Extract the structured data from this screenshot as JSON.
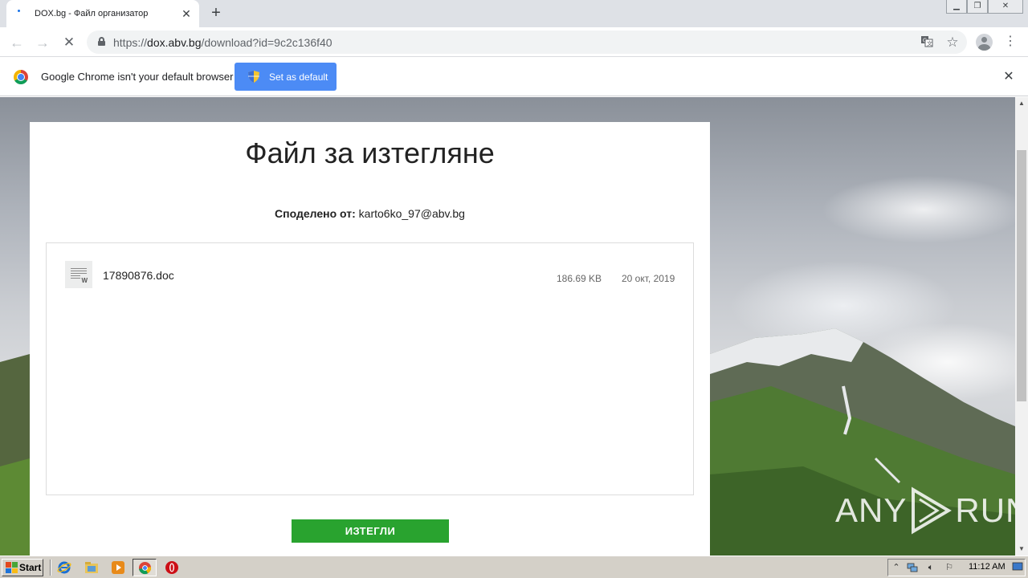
{
  "browser": {
    "tab": {
      "title": "DOX.bg - Файл организатор"
    },
    "url": {
      "scheme": "https://",
      "host": "dox.abv.bg",
      "path": "/download?id=9c2c136f40"
    },
    "infobar": {
      "message": "Google Chrome isn't your default browser",
      "button_label": "Set as default"
    }
  },
  "page": {
    "title": "Файл за изтегляне",
    "shared_by_label": "Споделено от:",
    "shared_by_value": "karto6ko_97@abv.bg",
    "file": {
      "name": "17890876.doc",
      "size": "186.69 KB",
      "date": "20 окт, 2019",
      "type_badge": "W"
    },
    "download_label": "ИЗТЕГЛИ"
  },
  "watermark": {
    "left": "ANY",
    "right": "RUN"
  },
  "taskbar": {
    "start_label": "Start",
    "clock": "11:12 AM",
    "apps": [
      "internet-explorer-icon",
      "folder-icon",
      "media-player-icon",
      "chrome-icon",
      "opera-icon"
    ]
  },
  "colors": {
    "download_green": "#29a32f",
    "chrome_blue": "#4c8bf5",
    "taskbar": "#d4d0c8"
  }
}
